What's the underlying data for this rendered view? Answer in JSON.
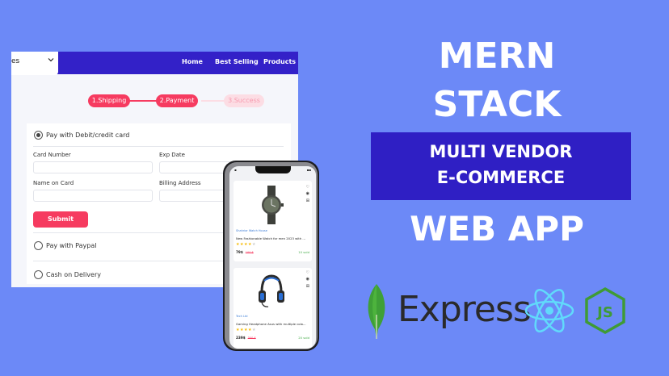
{
  "browser": {
    "dropdown_text": "es",
    "nav": [
      "Home",
      "Best Selling",
      "Products"
    ],
    "steps": [
      "1.Shipping",
      "2.Payment",
      "3.Success"
    ],
    "payment": {
      "option_card": "Pay with Debit/credit card",
      "card_number_label": "Card Number",
      "exp_date_label": "Exp Date",
      "name_on_card_label": "Name on Card",
      "billing_address_label": "Billing Address",
      "submit_label": "Submit",
      "option_paypal": "Pay with Paypal",
      "option_cod": "Cash on Delivery"
    }
  },
  "phone": {
    "products": [
      {
        "shop": "Shahriar Watch House",
        "name": "New Fashionable Watch for men 2023 with ...",
        "rating": 4,
        "price": "79$",
        "old_price": "100 $",
        "sold": "10 sold"
      },
      {
        "shop": "Tech Ltd",
        "name": "Gaming Headphone Asus with multiple colo...",
        "rating": 4,
        "price": "239$",
        "old_price": "300 $",
        "sold": "20 sold"
      }
    ]
  },
  "promo": {
    "line1": "MERN",
    "line2": "STACK",
    "banner_line1": "MULTI VENDOR",
    "banner_line2": "E-COMMERCE",
    "line3": "WEB APP",
    "express_label": "Express"
  },
  "colors": {
    "background": "#6c89f7",
    "navbar": "#3321c8",
    "accent": "#f63b60",
    "banner": "#2f1fc4"
  },
  "icons": [
    "chevron-down-icon",
    "heart-icon",
    "eye-icon",
    "cart-icon",
    "mongodb-logo",
    "react-logo",
    "nodejs-logo"
  ]
}
